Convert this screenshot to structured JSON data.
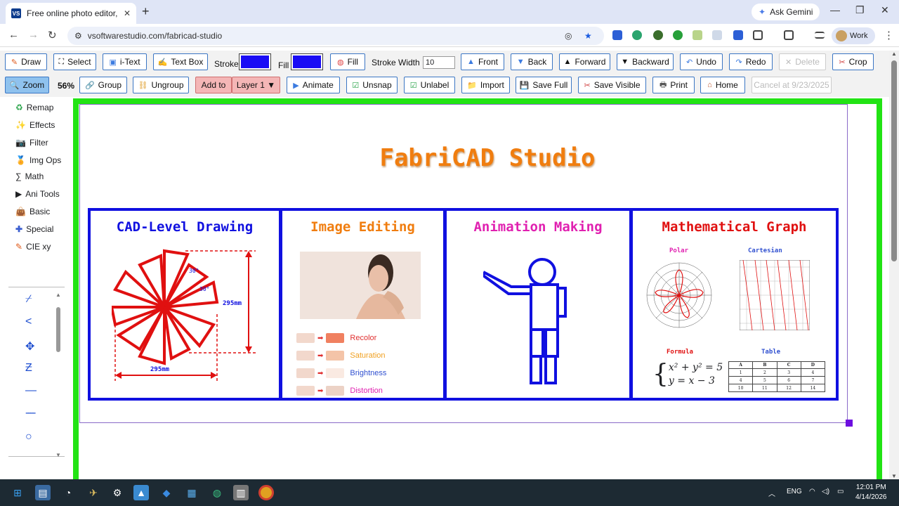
{
  "browser": {
    "tab_title": "Free online photo editor, anima",
    "favicon_text": "VS",
    "ask_gemini": "Ask Gemini",
    "url": "vsoftwarestudio.com/fabricad-studio",
    "profile": "Work"
  },
  "toolbar1": {
    "draw": "Draw",
    "select": "Select",
    "itext": "i-Text",
    "textbox": "Text Box",
    "stroke_label": "Stroke",
    "fill_label": "Fill",
    "fill_btn": "Fill",
    "stroke_width_label": "Stroke Width",
    "stroke_width_value": "10",
    "front": "Front",
    "back": "Back",
    "forward": "Forward",
    "backward": "Backward",
    "undo": "Undo",
    "redo": "Redo",
    "delete": "Delete",
    "crop": "Crop",
    "stroke_color": "#1a0cf5",
    "fill_color": "#1a0cf5"
  },
  "toolbar2": {
    "zoom": "Zoom",
    "zoom_level": "56%",
    "group": "Group",
    "ungroup": "Ungroup",
    "add_to": "Add to",
    "layer": "Layer 1 ▼",
    "animate": "Animate",
    "unsnap": "Unsnap",
    "unlabel": "Unlabel",
    "import": "Import",
    "save_full": "Save Full",
    "save_visible": "Save Visible",
    "print": "Print",
    "home": "Home",
    "cancel": "Cancel at 9/23/2025"
  },
  "sidebar": {
    "items": [
      "Remap",
      "Effects",
      "Filter",
      "Img Ops",
      "Math",
      "Ani Tools",
      "Basic",
      "Special",
      "CIE xy"
    ],
    "shape_icons": [
      "line-dash-icon",
      "angle-icon",
      "move-icon",
      "zigzag-icon",
      "line-icon",
      "dashed-line-icon",
      "circle-icon"
    ]
  },
  "canvas": {
    "title": "FabriCAD Studio",
    "panels": {
      "cad": "CAD-Level Drawing",
      "image": "Image Editing",
      "animation": "Animation Making",
      "math": "Mathematical Graph"
    },
    "cad_dims": {
      "angle1": "30°",
      "angle2": "30°",
      "height": "295mm",
      "width": "295mm"
    },
    "image_ops": [
      "Recolor",
      "Saturation",
      "Brightness",
      "Distortion"
    ],
    "math_labels": {
      "polar": "Polar",
      "cartesian": "Cartesian",
      "formula": "Formula",
      "table": "Table"
    },
    "formula_line1": "x² + y² = 5",
    "formula_line2": "y = x − 3",
    "table": {
      "headers": [
        "A",
        "B",
        "C",
        "D"
      ],
      "rows": [
        [
          "1",
          "2",
          "3",
          "4"
        ],
        [
          "4",
          "5",
          "6",
          "7"
        ],
        [
          "10",
          "11",
          "12",
          "14"
        ]
      ]
    },
    "accent_color": "#1010e0",
    "border_color": "#22e314"
  },
  "taskbar": {
    "lang": "ENG",
    "time": "12:01 PM",
    "date": "4/14/2026"
  }
}
